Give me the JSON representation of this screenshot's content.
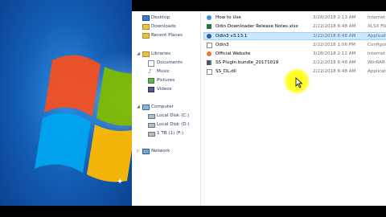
{
  "desktop": {
    "wallpaper": "windows-7-logo"
  },
  "nav": {
    "favorites": [
      {
        "label": "Desktop",
        "icon": "desktop-icon"
      },
      {
        "label": "Downloads",
        "icon": "downloads-icon"
      },
      {
        "label": "Recent Places",
        "icon": "recent-places-icon"
      }
    ],
    "libraries": {
      "label": "Libraries",
      "items": [
        {
          "label": "Documents",
          "icon": "documents-icon"
        },
        {
          "label": "Music",
          "icon": "music-icon"
        },
        {
          "label": "Pictures",
          "icon": "pictures-icon"
        },
        {
          "label": "Videos",
          "icon": "videos-icon"
        }
      ]
    },
    "computer": {
      "label": "Computer",
      "items": [
        {
          "label": "Local Disk (C:)",
          "icon": "drive-icon"
        },
        {
          "label": "Local Disk (D:)",
          "icon": "drive-icon"
        },
        {
          "label": "1 TB (1) (F:)",
          "icon": "drive-icon"
        }
      ]
    },
    "network": {
      "label": "Network"
    }
  },
  "files": [
    {
      "name": "How to Use",
      "date": "3/28/2018 2:13 AM",
      "type": "Internet",
      "icon": "internet-shortcut-icon"
    },
    {
      "name": "Odin Downloader Release Notes.xlsx",
      "date": "2/22/2018 6:48 AM",
      "type": "XLSX File",
      "icon": "excel-icon"
    },
    {
      "name": "Odin3 v3.13.1",
      "date": "2/22/2018 6:48 AM",
      "type": "Applicati",
      "icon": "odin-app-icon",
      "selected": true
    },
    {
      "name": "Odin3",
      "date": "2/22/2018 1:06 PM",
      "type": "Configura",
      "icon": "config-file-icon"
    },
    {
      "name": "Official Website",
      "date": "3/28/2018 2:12 AM",
      "type": "Internet",
      "icon": "internet-shortcut-icon"
    },
    {
      "name": "SS PlugIn.bundle_20171019",
      "date": "2/22/2018 6:48 AM",
      "type": "WinRAR",
      "icon": "winrar-icon"
    },
    {
      "name": "SS_DL.dll",
      "date": "2/22/2018 6:48 AM",
      "type": "Applicati",
      "icon": "dll-icon"
    }
  ],
  "colors": {
    "selection": "#cce8ff",
    "highlight": "#ffff00",
    "nav_text": "#1e395b"
  }
}
